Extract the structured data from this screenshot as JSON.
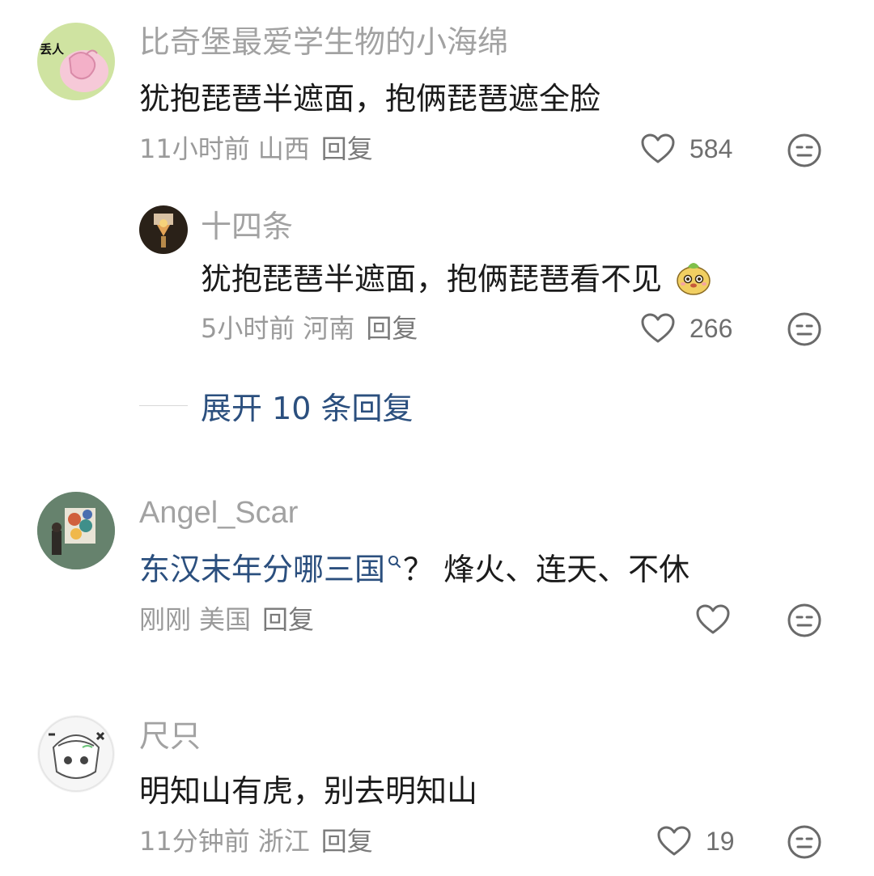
{
  "comments": [
    {
      "username": "比奇堡最爱学生物的小海绵",
      "avatar_badge": "丢人",
      "text": "犹抱琵琶半遮面，抱俩琵琶遮全脸",
      "time": "11小时前",
      "location": "山西",
      "reply_label": "回复",
      "likes": "584",
      "replies": [
        {
          "username": "十四条",
          "text": "犹抱琵琶半遮面，抱俩琵琶看不见",
          "emoji": "smiling-sticker-emoji",
          "time": "5小时前",
          "location": "河南",
          "reply_label": "回复",
          "likes": "266"
        }
      ],
      "expand_label": "展开 10 条回复"
    },
    {
      "username": "Angel_Scar",
      "text_link": "东汉末年分哪三国",
      "text_rest": "？ 烽火、连天、不休",
      "time": "刚刚",
      "location": "美国",
      "reply_label": "回复",
      "likes": ""
    },
    {
      "username": "尺只",
      "text": "明知山有虎，别去明知山",
      "time": "11分钟前",
      "location": "浙江",
      "reply_label": "回复",
      "likes": "19"
    }
  ],
  "icons": {
    "like": "heart-outline-icon",
    "dislike": "neutral-face-icon",
    "search": "search-icon"
  },
  "colors": {
    "link": "#2b4f7e",
    "username": "#a2a2a2",
    "text": "#1b1b1b"
  }
}
